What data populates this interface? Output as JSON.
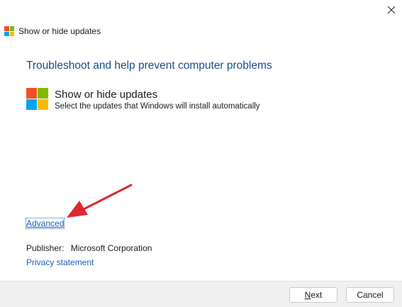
{
  "window": {
    "title": "Show or hide updates",
    "close_icon": "close-icon"
  },
  "content": {
    "heading": "Troubleshoot and help prevent computer problems",
    "option": {
      "icon": "windows-logo-icon",
      "title": "Show or hide updates",
      "description": "Select the updates that Windows will install automatically"
    },
    "advanced_link": "Advanced",
    "publisher": {
      "label": "Publisher:",
      "value": "Microsoft Corporation"
    },
    "privacy_link": "Privacy statement"
  },
  "footer": {
    "next_mnemonic": "N",
    "next_rest": "ext",
    "cancel_label": "Cancel"
  },
  "colors": {
    "logo_red": "#f25022",
    "logo_green": "#7fba00",
    "logo_blue": "#00a4ef",
    "logo_yellow": "#ffb900",
    "heading_blue": "#1a4b8c",
    "link_blue": "#1a5fb4",
    "annotation_arrow": "#e0262c"
  }
}
